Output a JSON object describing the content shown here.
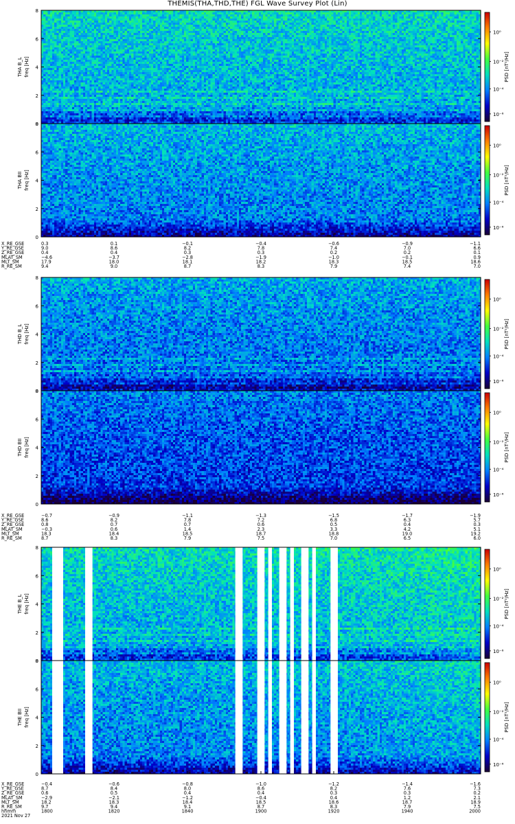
{
  "title": "THEMIS(THA,THD,THE) FGL Wave Survey Plot (Lin)",
  "colors": {
    "frame": "#000000",
    "gap": "#ffffff"
  },
  "chart_data": [
    {
      "type": "heatmap",
      "title": "THEMIS(THA,THD,THE) FGL Wave Survey Plot (Lin)",
      "probes": [
        {
          "name": "THA",
          "panels": [
            {
              "name": "THA B L",
              "ylabel": "THA B_L",
              "yunits": "freq [Hz]",
              "yticks": [
                0,
                2,
                4,
                6,
                8
              ],
              "ylim": [
                0,
                8
              ],
              "colorbar": {
                "label": "PSD [nT²/Hz]",
                "ticks": [
                  "10⁰",
                  "10⁻²",
                  "10⁻⁴",
                  "10⁻⁶"
                ]
              }
            },
            {
              "name": "THA BII",
              "ylabel": "THA BII",
              "yunits": "freq [Hz]",
              "yticks": [
                0,
                2,
                4,
                6,
                8
              ],
              "ylim": [
                0,
                8
              ],
              "colorbar": {
                "label": "PSD [nT²/Hz]",
                "ticks": [
                  "10⁰",
                  "10⁻²",
                  "10⁻⁴",
                  "10⁻⁶"
                ]
              }
            }
          ],
          "ephemeris": [
            {
              "label": "X_RE_GSE",
              "values": [
                "0.3",
                "0.1",
                "−0.1",
                "−0.4",
                "−0.6",
                "−0.9",
                "−1.1"
              ]
            },
            {
              "label": "Y_RE_GSE",
              "values": [
                "9.0",
                "8.6",
                "8.2",
                "7.8",
                "7.4",
                "7.0",
                "6.6"
              ]
            },
            {
              "label": "Z_RE_GSE",
              "values": [
                "0.4",
                "0.4",
                "0.3",
                "0.3",
                "0.2",
                "0.2",
                "0.1"
              ]
            },
            {
              "label": "MLAT_SM",
              "values": [
                "−4.6",
                "−3.7",
                "−2.8",
                "−1.9",
                "−1.0",
                "−0.1",
                "0.9"
              ]
            },
            {
              "label": "MLT_SM",
              "values": [
                "17.9",
                "18.0",
                "18.1",
                "18.2",
                "18.3",
                "18.5",
                "18.6"
              ]
            },
            {
              "label": "R_RE_SM",
              "values": [
                "9.4",
                "9.0",
                "8.7",
                "8.3",
                "7.9",
                "7.4",
                "7.0"
              ]
            }
          ]
        },
        {
          "name": "THD",
          "panels": [
            {
              "name": "THD B L",
              "ylabel": "THD B_L",
              "yunits": "freq [Hz]",
              "yticks": [
                0,
                2,
                4,
                6,
                8
              ],
              "ylim": [
                0,
                8
              ],
              "colorbar": {
                "label": "PSD [nT²/Hz]",
                "ticks": [
                  "10⁰",
                  "10⁻²",
                  "10⁻⁴",
                  "10⁻⁶"
                ]
              }
            },
            {
              "name": "THD BII",
              "ylabel": "THD BII",
              "yunits": "freq [Hz]",
              "yticks": [
                0,
                2,
                4,
                6,
                8
              ],
              "ylim": [
                0,
                8
              ],
              "colorbar": {
                "label": "PSD [nT²/Hz]",
                "ticks": [
                  "10⁰",
                  "10⁻²",
                  "10⁻⁴",
                  "10⁻⁶"
                ]
              }
            }
          ],
          "ephemeris": [
            {
              "label": "X_RE_GSE",
              "values": [
                "−0.7",
                "−0.9",
                "−1.1",
                "−1.3",
                "−1.5",
                "−1.7",
                "−1.9"
              ]
            },
            {
              "label": "Y_RE_GSE",
              "values": [
                "8.6",
                "8.2",
                "7.8",
                "7.2",
                "6.8",
                "6.3",
                "5.7"
              ]
            },
            {
              "label": "Z_RE_GSE",
              "values": [
                "0.8",
                "0.7",
                "0.7",
                "0.6",
                "0.5",
                "0.4",
                "0.3"
              ]
            },
            {
              "label": "MLAT_SM",
              "values": [
                "−0.3",
                "0.6",
                "1.4",
                "2.3",
                "3.3",
                "4.2",
                "5.1"
              ]
            },
            {
              "label": "MLT_SM",
              "values": [
                "18.3",
                "18.4",
                "18.5",
                "18.7",
                "18.8",
                "19.0",
                "19.2"
              ]
            },
            {
              "label": "R_RE_SM",
              "values": [
                "8.7",
                "8.3",
                "7.9",
                "7.5",
                "7.0",
                "6.5",
                "6.0"
              ]
            }
          ]
        },
        {
          "name": "THE",
          "panels": [
            {
              "name": "THE B L",
              "ylabel": "THE B_L",
              "yunits": "freq [Hz]",
              "yticks": [
                0,
                2,
                4,
                6,
                8
              ],
              "ylim": [
                0,
                8
              ],
              "colorbar": {
                "label": "PSD [nT²/Hz]",
                "ticks": [
                  "10⁰",
                  "10⁻²",
                  "10⁻⁴",
                  "10⁻⁶"
                ]
              }
            },
            {
              "name": "THE BII",
              "ylabel": "THE BII",
              "yunits": "freq [Hz]",
              "yticks": [
                0,
                2,
                4,
                6,
                8
              ],
              "ylim": [
                0,
                8
              ],
              "colorbar": {
                "label": "PSD [nT²/Hz]",
                "ticks": [
                  "10⁰",
                  "10⁻²",
                  "10⁻⁴",
                  "10⁻⁶"
                ]
              }
            }
          ],
          "data_gaps_hhmm": [
            [
              "1803",
              "1806"
            ],
            [
              "1812",
              "1814"
            ],
            [
              "1853",
              "1855"
            ],
            [
              "1859",
              "1901"
            ],
            [
              "1902",
              "1903"
            ],
            [
              "1905",
              "1907"
            ],
            [
              "1908",
              "1909"
            ],
            [
              "1911",
              "1913"
            ],
            [
              "1914",
              "1915"
            ],
            [
              "1919",
              "1921"
            ]
          ],
          "ephemeris": [
            {
              "label": "X_RE_GSE",
              "values": [
                "−0.4",
                "−0.6",
                "−0.8",
                "−1.0",
                "−1.2",
                "−1.4",
                "−1.6"
              ]
            },
            {
              "label": "Y_RE_GSE",
              "values": [
                "8.7",
                "8.4",
                "8.0",
                "8.6",
                "8.2",
                "7.6",
                "7.3"
              ]
            },
            {
              "label": "Z_RE_GSE",
              "values": [
                "0.6",
                "0.5",
                "0.4",
                "0.4",
                "0.3",
                "0.3",
                "0.2"
              ]
            },
            {
              "label": "MLAT_SM",
              "values": [
                "−2.9",
                "−2.1",
                "−1.2",
                "−0.4",
                "0.4",
                "1.2",
                "2.1"
              ]
            },
            {
              "label": "MLT_SM",
              "values": [
                "18.2",
                "18.3",
                "18.4",
                "18.5",
                "18.6",
                "18.7",
                "18.9"
              ]
            },
            {
              "label": "R_RE_SM",
              "values": [
                "9.7",
                "9.4",
                "9.1",
                "8.7",
                "8.3",
                "7.9",
                "7.5"
              ]
            },
            {
              "label": "hhmm",
              "values": [
                "1800",
                "1820",
                "1840",
                "1900",
                "1920",
                "1940",
                "2000"
              ]
            }
          ],
          "date": "2021 Nov 27"
        }
      ],
      "x": {
        "label": "hhmm",
        "ticks": [
          "1800",
          "1820",
          "1840",
          "1900",
          "1920",
          "1940",
          "2000"
        ],
        "range": [
          "1800",
          "2000"
        ]
      },
      "color_scale": {
        "type": "log",
        "range": [
          "10⁻⁶",
          "10⁰"
        ],
        "colormap": [
          "#1a0033",
          "#0000c8",
          "#0080ff",
          "#00e0c0",
          "#40ff40",
          "#ffff00",
          "#ff8000",
          "#cc0000"
        ]
      }
    }
  ]
}
